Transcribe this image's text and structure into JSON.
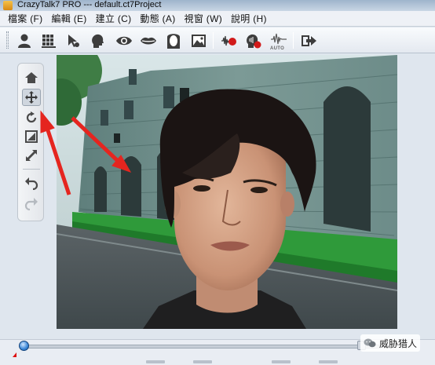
{
  "window": {
    "title": "CrazyTalk7 PRO --- default.ct7Project"
  },
  "menu": {
    "items": [
      "檔案 (F)",
      "編輯 (E)",
      "建立 (C)",
      "動態 (A)",
      "視窗 (W)",
      "說明 (H)"
    ]
  },
  "toolbar": {
    "auto_label": "AUTO",
    "icons": [
      "person-icon",
      "grid-layout-icon",
      "pointer-move-icon",
      "head-silhouette-icon",
      "eye-icon",
      "lips-icon",
      "face-outline-icon",
      "image-icon",
      "voice-record-icon",
      "head-voice-icon",
      "auto-wave-icon",
      "export-icon"
    ]
  },
  "side_tools": {
    "icons": [
      "home-icon",
      "move-icon",
      "rotate-icon",
      "scale-icon",
      "resize-diagonal-icon",
      "undo-icon",
      "redo-icon"
    ],
    "active": "move-icon"
  },
  "timeline": {
    "progress": 0.0
  },
  "watermark": {
    "text": "威胁猎人"
  },
  "colors": {
    "accent_red": "#e5251f",
    "thumb_blue": "#3a86d6",
    "grass_green": "#2f9a3a"
  }
}
